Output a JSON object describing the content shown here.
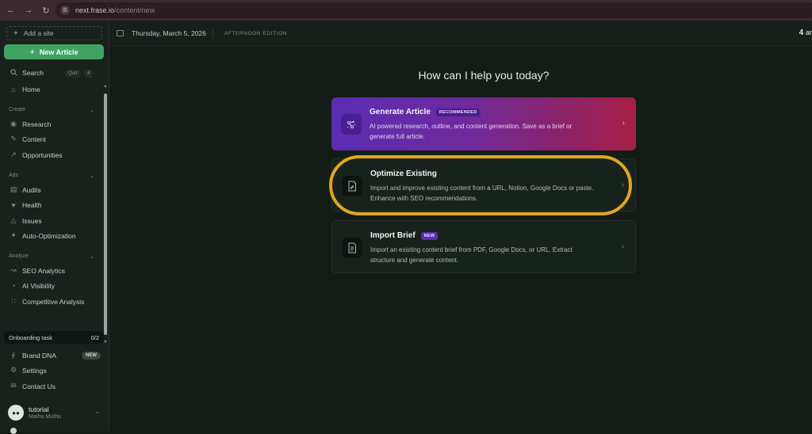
{
  "browser": {
    "url_host": "next.frase.io",
    "url_path": "/content/new"
  },
  "sidebar": {
    "add_site": "Add a site",
    "new_article": "New Article",
    "search": {
      "label": "Search",
      "shortcut": "Qurt",
      "shortcut2": "4"
    },
    "home": "Home",
    "sections": {
      "create": "Create",
      "ads": "Ads",
      "analyze": "Analyze"
    },
    "create_items": [
      "Research",
      "Content",
      "Opportunities"
    ],
    "ads_items": [
      "Audits",
      "Health",
      "Issues",
      "Auto-Optimization"
    ],
    "analyze_items": [
      "SEO Analytics",
      "AI Visibility",
      "Competitive Analysis"
    ],
    "onboarding": {
      "label": "Onboarding task",
      "progress": "0/2"
    },
    "brand_dna": {
      "label": "Brand DNA",
      "badge": "NEW"
    },
    "settings": "Settings",
    "contact": "Contact Us",
    "user": {
      "name": "tutorial",
      "sub": "Mathu Muthu"
    }
  },
  "topbar": {
    "date": "Thursday, March 5, 2026",
    "edition": "AFTERNOON EDITION",
    "right_num": "4",
    "right_suffix": "ar"
  },
  "main": {
    "heading": "How can I help you today?",
    "cards": [
      {
        "title": "Generate Article",
        "tag": "RECOMMENDED",
        "desc_line1": "AI powered research, outline, and content generation. Save as a brief or",
        "desc_line2": "generate full article."
      },
      {
        "title": "Optimize Existing",
        "desc_line1": "Import and improve existing content from a URL, Notion, Google Docs or paste.",
        "desc_line2": "Enhance with SEO recommendations."
      },
      {
        "title": "Import Brief",
        "tag": "NEW",
        "desc_line1": "Import an existing content brief from PDF, Google Docs, or URL. Extract",
        "desc_line2": "structure and generate content."
      }
    ]
  },
  "colors": {
    "accent_green": "#3fa463",
    "highlight_ring": "#e0a61f",
    "gradient_start": "#5a2cb3",
    "gradient_end": "#a61f47"
  }
}
